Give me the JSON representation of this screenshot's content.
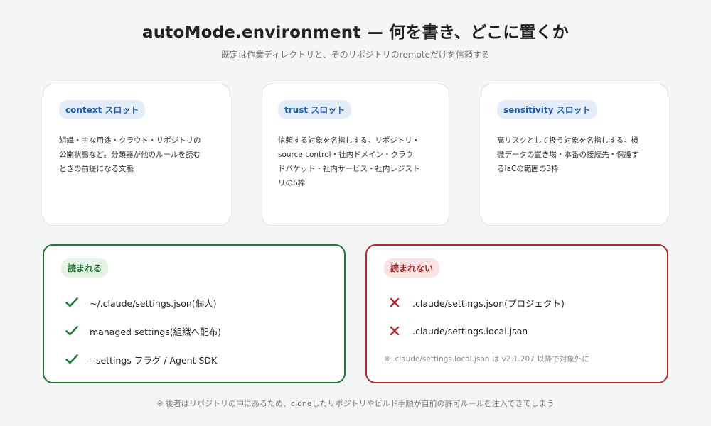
{
  "header": {
    "title": "autoMode.environment — 何を書き、どこに置くか",
    "subtitle": "既定は作業ディレクトリと、そのリポジトリのremoteだけを信頼する"
  },
  "slots": [
    {
      "tag": "context スロット",
      "description": "組織・主な用途・クラウド・リポジトリの公開状態など。分類器が他のルールを読むときの前提になる文脈"
    },
    {
      "tag": "trust スロット",
      "description": "信頼する対象を名指しする。リポジトリ・source control・社内ドメイン・クラウドバケット・社内サービス・社内レジストリの6枠"
    },
    {
      "tag": "sensitivity スロット",
      "description": "高リスクとして扱う対象を名指しする。機微データの置き場・本番の接続先・保護するIaCの範囲の3枠"
    }
  ],
  "read_panel": {
    "tag": "読まれる",
    "items": [
      "~/.claude/settings.json(個人)",
      "managed settings(組織へ配布)",
      "--settings フラグ / Agent SDK"
    ]
  },
  "unread_panel": {
    "tag": "読まれない",
    "items": [
      ".claude/settings.json(プロジェクト)",
      ".claude/settings.local.json"
    ],
    "note": "※ .claude/settings.local.json は v2.1.207 以降で対象外に"
  },
  "footnote": "※ 後者はリポジトリの中にあるため、cloneしたリポジトリやビルド手順が自前の許可ルールを注入できてしまう",
  "colors": {
    "ok": "#1e7b34",
    "ng": "#b42a2a",
    "slot_accent": "#1f5fae"
  },
  "icons": {
    "ok": "check-icon",
    "ng": "cross-icon"
  }
}
